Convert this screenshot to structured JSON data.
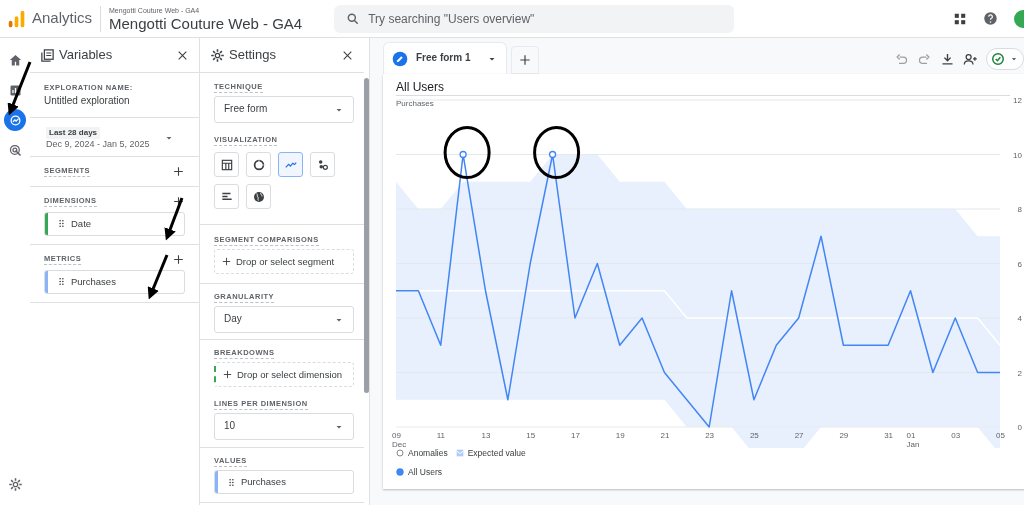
{
  "app": {
    "name": "Analytics",
    "property_caption": "Mengotti Couture Web - GA4",
    "property": "Mengotti Couture Web - GA4",
    "search": {
      "placeholder": "Try searching \"Users overview\""
    }
  },
  "nav_rail": [
    {
      "kind": "home",
      "selected": false
    },
    {
      "kind": "reports",
      "selected": false
    },
    {
      "kind": "explore",
      "selected": true
    },
    {
      "kind": "advertising",
      "selected": false
    },
    {
      "kind": "settings",
      "selected": false
    }
  ],
  "variables": {
    "title": "Variables",
    "exploration_name_label": "EXPLORATION NAME:",
    "exploration_name": "Untitled exploration",
    "date_range": {
      "badge": "Last 28 days",
      "range": "Dec 9, 2024 - Jan 5, 2025"
    },
    "sections": [
      {
        "label": "SEGMENTS"
      },
      {
        "label": "DIMENSIONS",
        "items": [
          {
            "name": "Date",
            "color": "#34a853"
          }
        ]
      },
      {
        "label": "METRICS",
        "items": [
          {
            "name": "Purchases",
            "color": "#8ab4f8"
          }
        ]
      }
    ]
  },
  "settings": {
    "title": "Settings",
    "technique": {
      "label": "TECHNIQUE",
      "value": "Free form"
    },
    "visualization": {
      "label": "VISUALIZATION",
      "options": [
        {
          "kind": "table",
          "selected": false
        },
        {
          "kind": "donut",
          "selected": false
        },
        {
          "kind": "line",
          "selected": true
        },
        {
          "kind": "scatter",
          "selected": false
        },
        {
          "kind": "bar",
          "selected": false
        },
        {
          "kind": "geo",
          "selected": false
        }
      ]
    },
    "segment_comparisons": {
      "label": "SEGMENT COMPARISONS",
      "drop": "Drop or select segment"
    },
    "granularity": {
      "label": "GRANULARITY",
      "value": "Day"
    },
    "breakdowns": {
      "label": "BREAKDOWNS",
      "drop": "Drop or select dimension"
    },
    "lines_per_dimension": {
      "label": "LINES PER DIMENSION",
      "value": "10"
    },
    "values": {
      "label": "VALUES",
      "items": [
        {
          "name": "Purchases",
          "color": "#8ab4f8"
        }
      ]
    }
  },
  "tabs": [
    {
      "label": "Free form 1",
      "selected": true
    }
  ],
  "chart": {
    "title": "All Users",
    "legend": [
      {
        "kind": "anomaly",
        "label": "Anomalies"
      }
    ],
    "chart_data": {
      "type": "line",
      "ylabel": "Purchases",
      "grid": true,
      "categories": [
        "09\nDec",
        null,
        "11",
        null,
        "13",
        null,
        "15",
        null,
        "17",
        null,
        "19",
        null,
        "21",
        null,
        "23",
        null,
        "25",
        null,
        "27",
        null,
        "29",
        null,
        "31",
        "01\nJan",
        null,
        "03",
        null,
        "05"
      ],
      "ylim": [
        0,
        12
      ],
      "yticks": [
        0,
        2,
        4,
        6,
        8,
        10,
        12
      ],
      "series": [
        {
          "name": "All Users",
          "color": "#4285f4",
          "values": [
            5,
            5,
            3,
            10,
            5,
            1,
            6,
            10,
            4,
            6,
            3,
            4,
            2,
            1,
            0,
            5,
            1,
            3,
            4,
            7,
            3,
            3,
            3,
            5,
            2,
            4,
            2,
            2
          ]
        },
        {
          "name": "Expected value",
          "color": "#ffffff",
          "values": [
            5,
            5,
            5,
            5,
            5,
            5,
            5,
            5,
            5,
            5,
            5,
            5,
            5,
            4,
            4,
            4,
            4,
            4,
            4,
            4,
            4,
            4,
            4,
            4,
            4,
            4,
            4,
            3
          ]
        }
      ]
    }
  }
}
